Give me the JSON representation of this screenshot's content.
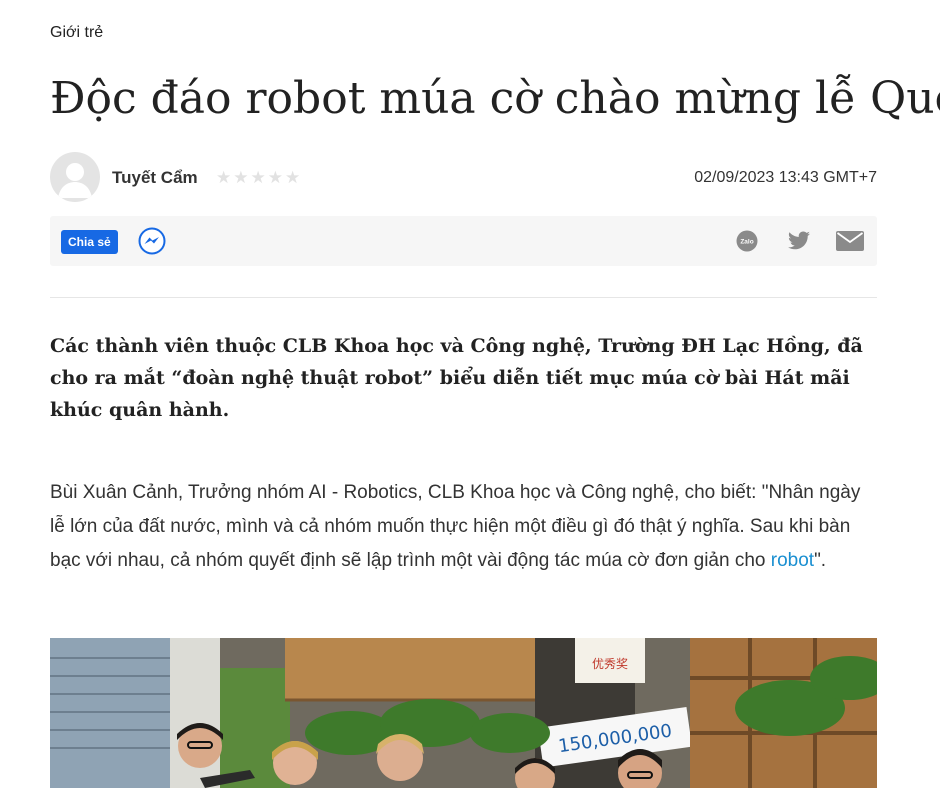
{
  "category": "Giới trẻ",
  "article": {
    "title": "Độc đáo robot múa cờ chào mừng lễ Quốc khánh",
    "author": "Tuyết Cẩm",
    "rating_stars": "★★★★★",
    "timestamp": "02/09/2023 13:43 GMT+7"
  },
  "share": {
    "label": "Chia sẻ",
    "icons": [
      "messenger-icon",
      "zalo-icon",
      "twitter-icon",
      "mail-icon"
    ],
    "zalo_text": "Zalo"
  },
  "sapo": "Các thành viên thuộc CLB Khoa học và Công nghệ, Trường ĐH Lạc Hồng, đã cho ra mắt “đoàn nghệ thuật robot” biểu diễn tiết mục múa cờ bài Hát mãi khúc quân hành.",
  "paragraph": {
    "before_link": "Bùi Xuân Cảnh, Trưởng nhóm AI - Robotics, CLB Khoa học và Công nghệ, cho biết: \"Nhân ngày lễ lớn của đất nước, mình và cả nhóm muốn thực hiện một điều gì đó thật ý nghĩa. Sau khi bàn bạc với nhau, cả nhóm quyết định sẽ lập trình một vài động tác múa cờ đơn giản cho ",
    "link_text": "robot",
    "after_link": "\"."
  },
  "photo": {
    "poster_amount": "150,000,000",
    "poster_sign": "优秀奖"
  },
  "colors": {
    "share_button": "#1769e4",
    "link": "#1a8fd1",
    "icon_gray": "#8a8a8a"
  }
}
